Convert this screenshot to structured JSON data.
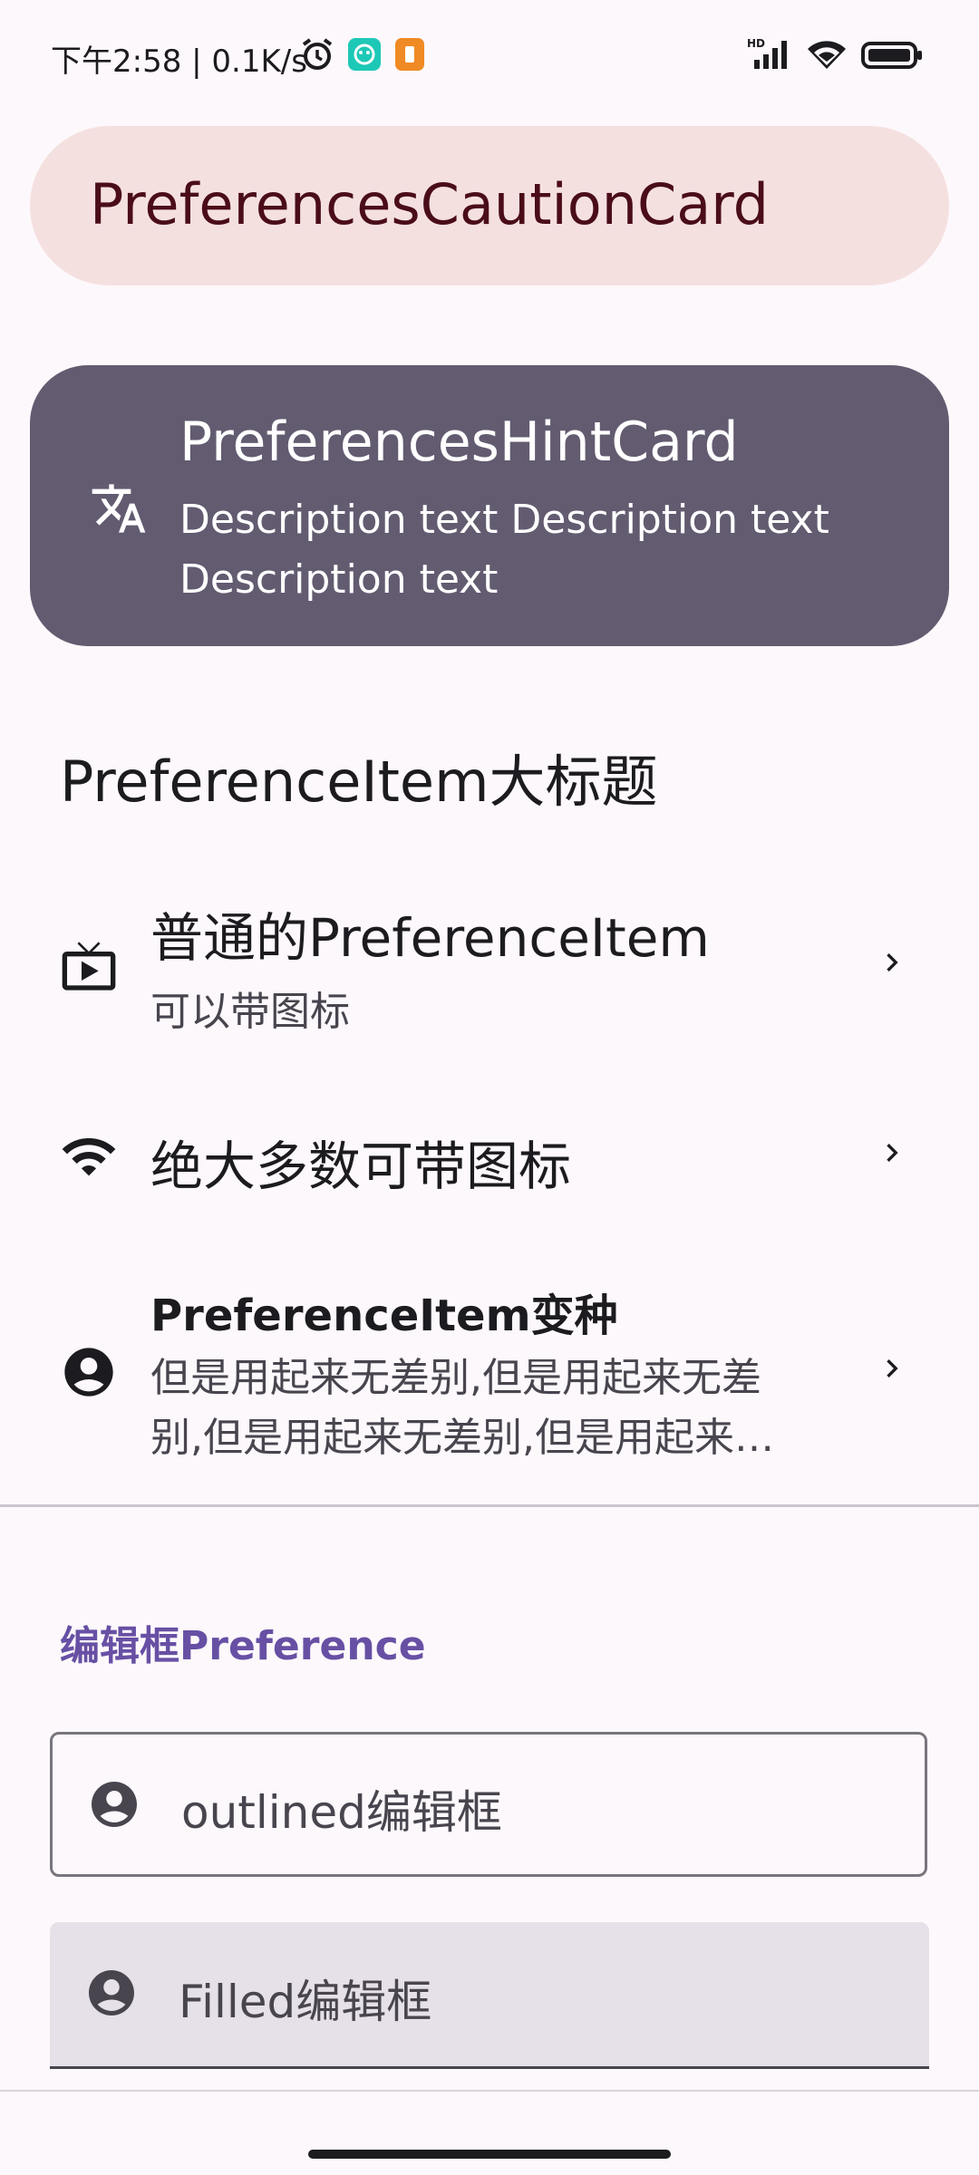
{
  "status_bar": {
    "time": "下午2:58 | 0.1K/s",
    "network_label": "HD"
  },
  "caution_card": {
    "title": "PreferencesCautionCard"
  },
  "hint_card": {
    "title": "PreferencesHintCard",
    "description": "Description text Description text Description text",
    "icon": "translate-icon"
  },
  "section": {
    "title": "PreferenceItem大标题"
  },
  "items": [
    {
      "title": "普通的PreferenceItem",
      "subtitle": "可以带图标",
      "icon": "tv-icon"
    },
    {
      "title": "绝大多数可带图标",
      "icon": "wifi-icon"
    },
    {
      "title": "PreferenceItem变种",
      "subtitle": "但是用起来无差别,但是用起来无差别,但是用起来无差别,但是用起来…",
      "icon": "account-circle-icon"
    }
  ],
  "edit_category": {
    "title": "编辑框Preference"
  },
  "fields": {
    "outlined_placeholder": "outlined编辑框",
    "filled_placeholder": "Filled编辑框"
  },
  "colors": {
    "caution_bg": "#f5e0e0",
    "hint_bg": "#635b70",
    "accent": "#6750a4",
    "filled_bg": "#e6e0e9"
  }
}
